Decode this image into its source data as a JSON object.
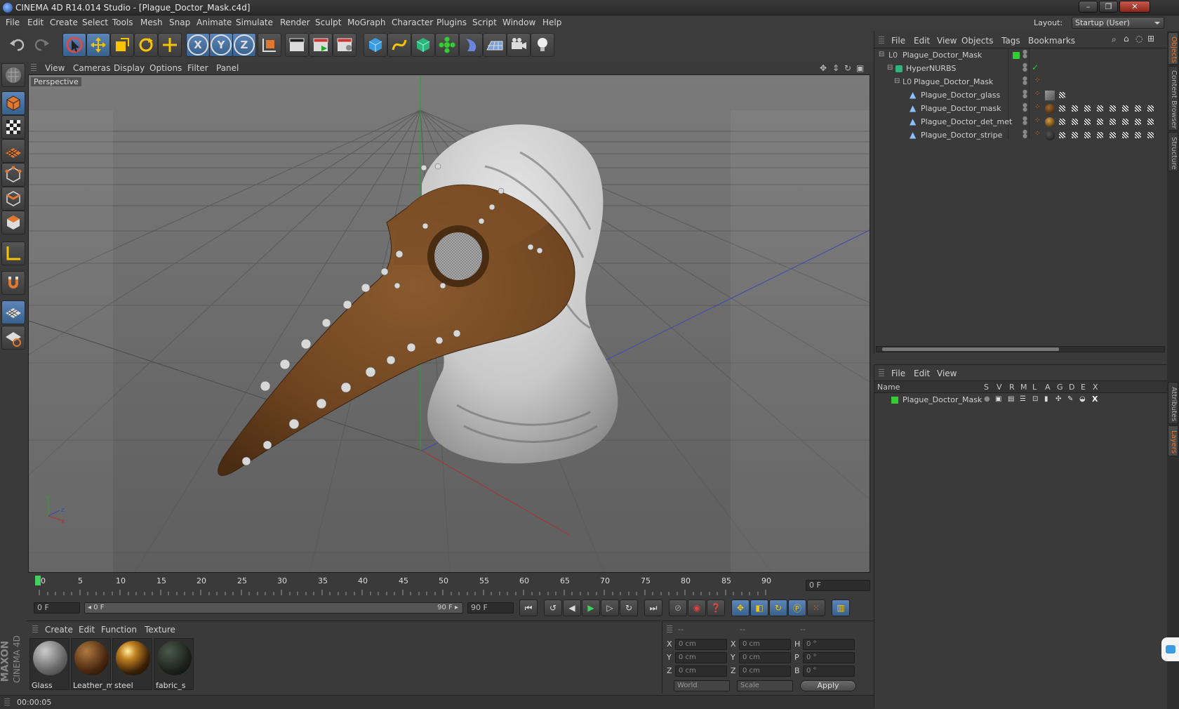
{
  "window": {
    "title": "CINEMA 4D R14.014 Studio - [Plague_Doctor_Mask.c4d]",
    "min": "–",
    "max": "❐",
    "close": "✕"
  },
  "menu": [
    "File",
    "Edit",
    "Create",
    "Select",
    "Tools",
    "Mesh",
    "Snap",
    "Animate",
    "Simulate",
    "Render",
    "Sculpt",
    "MoGraph",
    "Character",
    "Plugins",
    "Script",
    "Window",
    "Help"
  ],
  "layout": {
    "label": "Layout:",
    "value": "Startup (User)"
  },
  "toolbar": {
    "x": "X",
    "y": "Y",
    "z": "Z"
  },
  "viewport": {
    "menu": [
      "View",
      "Cameras",
      "Display",
      "Options",
      "Filter",
      "Panel"
    ],
    "label": "Perspective"
  },
  "objects": {
    "menu": [
      "File",
      "Edit",
      "View",
      "Objects",
      "Tags",
      "Bookmarks"
    ],
    "items": [
      {
        "name": "Plague_Doctor_Mask"
      },
      {
        "name": "HyperNURBS"
      },
      {
        "name": "Plague_Doctor_Mask"
      },
      {
        "name": "Plague_Doctor_glass"
      },
      {
        "name": "Plague_Doctor_mask"
      },
      {
        "name": "Plague_Doctor_det_met"
      },
      {
        "name": "Plague_Doctor_stripe"
      }
    ]
  },
  "layers": {
    "menu": [
      "File",
      "Edit",
      "View"
    ],
    "header": {
      "name": "Name",
      "cols": [
        "S",
        "V",
        "R",
        "M",
        "L",
        "A",
        "G",
        "D",
        "E",
        "X"
      ]
    },
    "items": [
      {
        "name": "Plague_Doctor_Mask"
      }
    ]
  },
  "sidetabs": [
    "Objects",
    "Content Browser",
    "Structure",
    "Attributes",
    "Layers"
  ],
  "timeline": {
    "ticks": [
      "0",
      "5",
      "10",
      "15",
      "20",
      "25",
      "30",
      "35",
      "40",
      "45",
      "50",
      "55",
      "60",
      "65",
      "70",
      "75",
      "80",
      "85",
      "90"
    ],
    "frame_field": "0 F"
  },
  "transport": {
    "start": "0 F",
    "range_start": "◂ 0 F",
    "range_end": "90 F ▸",
    "end": "90 F"
  },
  "materials": {
    "menu": [
      "Create",
      "Edit",
      "Function",
      "Texture"
    ],
    "items": [
      {
        "name": "Glass"
      },
      {
        "name": "Leather_m"
      },
      {
        "name": "steel"
      },
      {
        "name": "fabric_s"
      }
    ]
  },
  "coords": {
    "header": [
      "--",
      "--",
      "--"
    ],
    "rows": [
      {
        "a": "X",
        "av": "0 cm",
        "b": "X",
        "bv": "0 cm",
        "c": "H",
        "cv": "0 °"
      },
      {
        "a": "Y",
        "av": "0 cm",
        "b": "Y",
        "bv": "0 cm",
        "c": "P",
        "cv": "0 °"
      },
      {
        "a": "Z",
        "av": "0 cm",
        "b": "Z",
        "bv": "0 cm",
        "c": "B",
        "cv": "0 °"
      }
    ],
    "world": "World",
    "scale": "Scale",
    "apply": "Apply"
  },
  "status": {
    "time": "00:00:05"
  },
  "brand": {
    "line1": "MAXON",
    "line2": "CINEMA 4D"
  }
}
